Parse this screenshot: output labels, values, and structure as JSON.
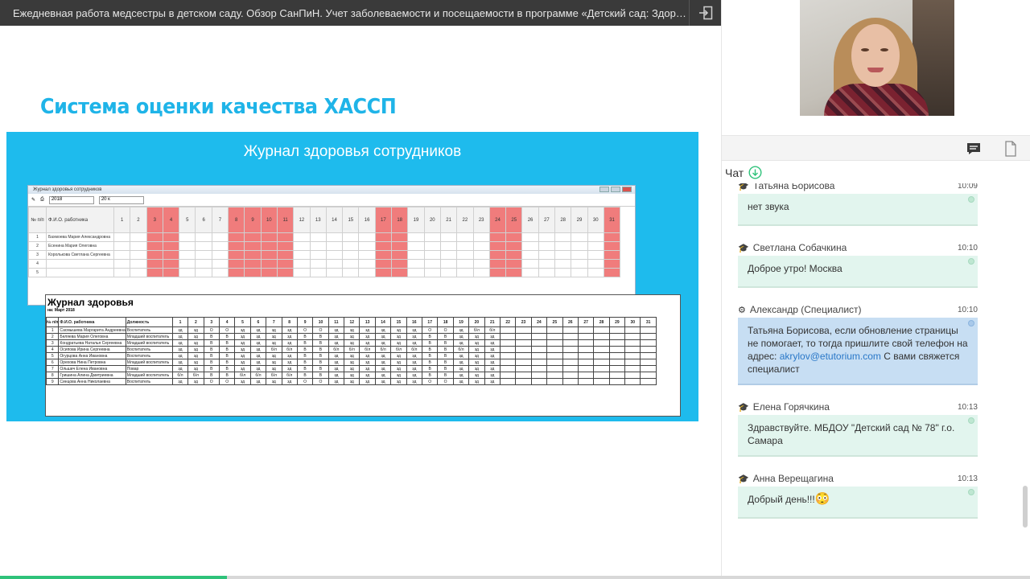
{
  "topbar": {
    "title": "Ежедневная работа медсестры в детском саду. Обзор СанПиН. Учет заболеваемости и посещаемости в программе «Детский сад: Здоро...",
    "exit_icon": "exit-icon"
  },
  "slide": {
    "heading": "Система оценки качества ХАССП",
    "box_title": "Журнал здоровья сотрудников",
    "back_window": {
      "title": "Журнал здоровья сотрудников",
      "field1": "2018",
      "field2": "20 к",
      "header_num": "№ п/п",
      "header_name": "Ф.И.О. работника",
      "day_headers": [
        "1",
        "2",
        "3",
        "4",
        "5",
        "6",
        "7",
        "8",
        "9",
        "10",
        "11",
        "12",
        "13",
        "14",
        "15",
        "16",
        "17",
        "18",
        "19",
        "20",
        "21",
        "22",
        "23",
        "24",
        "25",
        "26",
        "27",
        "28",
        "29",
        "30",
        "31"
      ],
      "red_days": [
        3,
        4,
        8,
        9,
        10,
        11,
        17,
        18,
        24,
        25,
        31
      ],
      "rows": [
        {
          "num": "1",
          "name": "Бахмоева Мария Александровна"
        },
        {
          "num": "2",
          "name": "Есенина Мария Олеговна"
        },
        {
          "num": "3",
          "name": "Королькова Светлана Сергеевна"
        },
        {
          "num": "4",
          "name": ""
        },
        {
          "num": "5",
          "name": ""
        }
      ]
    },
    "journal": {
      "title": "Журнал здоровья",
      "subtitle": "на: Март 2018",
      "col_num": "№ п/п",
      "col_name": "Ф.И.О. работника",
      "col_pos": "Должность",
      "month_label": "Месяц/день",
      "rows": [
        {
          "num": "1",
          "name": "Сасмышева Маргарита Андреевна",
          "pos": "Воспитатель",
          "marks": "зд зд О О зд зд зд зд О О зд зд зд зд зд зд О О зд б/л б/л"
        },
        {
          "num": "2",
          "name": "Беляева Мария Олеговна",
          "pos": "Младший воспитатель",
          "marks": "зд зд В В зд зд зд зд В В зд зд зд зд зд зд В В зд зд зд"
        },
        {
          "num": "3",
          "name": "Кондратьева Наталья Сергеевна",
          "pos": "Младший воспитатель",
          "marks": "зд зд В В зд зд зд зд В В зд зд зд зд зд зд В В зд зд зд"
        },
        {
          "num": "4",
          "name": "Осипова Ирина Сергеевна",
          "pos": "Воспитатель",
          "marks": "зд зд В В зд зд б/л б/л В В б/л б/л б/л б/л б/л б/л В В б/л зд зд"
        },
        {
          "num": "5",
          "name": "Огурцова Анна Ивановна",
          "pos": "Воспитатель",
          "marks": "зд зд В В зд зд зд зд В В зд зд зд зд зд зд В В зд зд зд"
        },
        {
          "num": "6",
          "name": "Орехова Нина Петровна",
          "pos": "Младший воспитатель",
          "marks": "зд зд В В зд зд зд зд В В зд зд зд зд зд зд В В зд зд зд"
        },
        {
          "num": "7",
          "name": "Ольшич Елена Ивановна",
          "pos": "Повар",
          "marks": "зд зд В В зд зд зд зд В В зд зд зд зд зд зд В В зд зд зд"
        },
        {
          "num": "8",
          "name": "Гришина Алина Дмитриевна",
          "pos": "Младший воспитатель",
          "marks": "б/л б/л В В б/л б/л б/л б/л В В зд зд зд зд зд зд В В зд зд зд"
        },
        {
          "num": "9",
          "name": "Синцова Анна Николаевна",
          "pos": "Воспитатель",
          "marks": "зд зд О О зд зд зд зд О О зд зд зд зд зд зд О О зд зд зд"
        }
      ]
    }
  },
  "sidebar": {
    "chat_tab_icon": "chat-icon",
    "files_tab_icon": "document-icon",
    "chat_label": "Чат",
    "messages": [
      {
        "author": "Татьяна Борисова",
        "time": "10:09",
        "role_icon": "graduation-cap-icon",
        "text": "нет звука",
        "style": "green"
      },
      {
        "author": "Светлана Собачкина",
        "time": "10:10",
        "role_icon": "graduation-cap-icon",
        "text": "Доброе утро! Москва",
        "style": "green"
      },
      {
        "author": "Александр (Специалист)",
        "time": "10:10",
        "role_icon": "gear-icon",
        "text_before": "Татьяна Борисова, если обновление страницы не помогает, то тогда пришлите свой телефон на адрес: ",
        "link": "akrylov@etutorium.com",
        "text_after": " С вами свяжется специалист",
        "style": "blue"
      },
      {
        "author": "Елена Горячкина",
        "time": "10:13",
        "role_icon": "graduation-cap-icon",
        "text": "Здравствуйте. МБДОУ \"Детский сад № 78\" г.о. Самара",
        "style": "green"
      },
      {
        "author": "Анна Верещагина",
        "time": "10:13",
        "role_icon": "graduation-cap-icon",
        "text": "Добрый день!!!",
        "emoji": "😳",
        "style": "green"
      }
    ]
  },
  "progress": {
    "fraction": 0.22,
    "color": "#2fc27a"
  },
  "colors": {
    "accent": "#1ebbed",
    "topbar": "#3a3a3a",
    "chat_green": "#e2f5ee",
    "chat_blue": "#c7def3"
  }
}
